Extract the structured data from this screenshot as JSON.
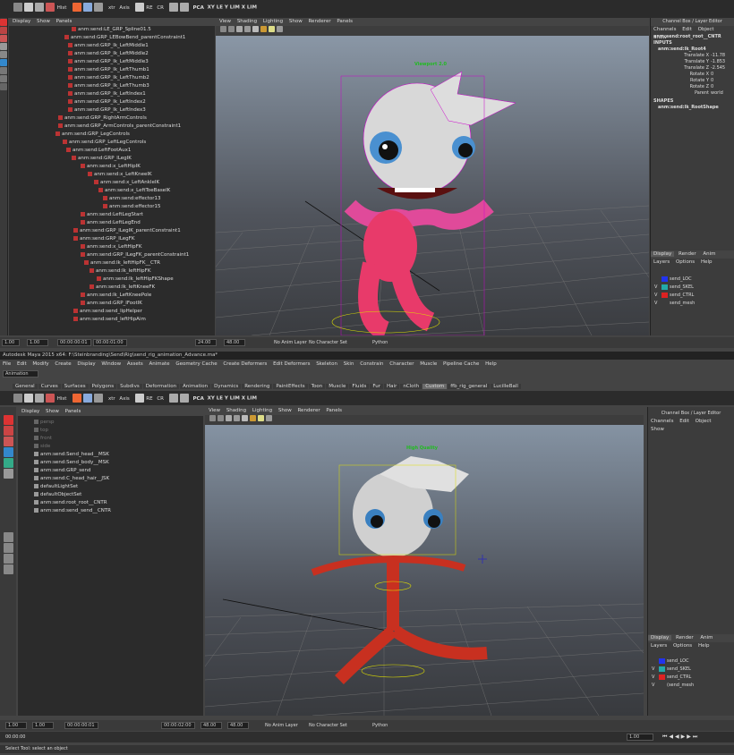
{
  "top": {
    "shelf_labels": [
      "Hist",
      "PCA",
      "XY LE Y LIM X LIM",
      "xtr",
      "Axis",
      "CR",
      "RE"
    ],
    "outliner_menu": [
      "Display",
      "Show",
      "Panels"
    ],
    "outliner_items": [
      "anm:send:LE_GRP_Spline01.5",
      "anm:send:GRP_LEBowBend_parentConstraint1",
      "anm:send:GRP_lk_LeftMiddle1",
      "anm:send:GRP_lk_LeftMiddle2",
      "anm:send:GRP_lk_LeftMiddle3",
      "anm:send:GRP_lk_LeftThumb1",
      "anm:send:GRP_lk_LeftThumb2",
      "anm:send:GRP_lk_LeftThumb3",
      "anm:send:GRP_lk_LeftIndex1",
      "anm:send:GRP_lk_LeftIndex2",
      "anm:send:GRP_lk_LeftIndex3",
      "anm:send:GRP_RightArmControls",
      "anm:send:GRP_ArmControls_parentConstraint1",
      "anm:send:GRP_LegControls",
      "anm:send:GRP_LeftLegControls",
      "anm:send:LeftFootAux1",
      "anm:send:GRP_lLegIK",
      "anm:send:x_LeftHipIK",
      "anm:send:x_LeftKneeIK",
      "anm:send:x_LeftAnkleIK",
      "anm:send:x_LeftToeBaseIK",
      "anm:send:effector13",
      "anm:send:effector15",
      "anm:send:LeftLegStart",
      "anm:send:LeftLegEnd",
      "anm:send:GRP_lLegIK_parentConstraint1",
      "anm:send:GRP_lLegFK",
      "anm:send:x_LeftHipFK",
      "anm:send:GRP_lLegFK_parentConstraint1",
      "anm:send:lk_leftHipFK__CTR",
      "anm:send:lk_leftHipFK",
      "anm:send:lk_leftHipFKShape",
      "anm:send:lk_leftKneeFK",
      "anm:send:lk_LeftKneePole",
      "anm:send:GRP_lFootIK",
      "anm:send:send_lipHelper",
      "anm:send:send_leftHipAim"
    ],
    "viewport_menu": [
      "View",
      "Shading",
      "Lighting",
      "Show",
      "Renderer",
      "Panels"
    ],
    "viewport_label": "Viewport 2.0",
    "channelbox_title": "Channel Box / Layer Editor",
    "channelbox_menu": [
      "Channels",
      "Edit",
      "Object",
      "Show"
    ],
    "node_name": "anm:send:root_root__CNTR",
    "inputs_label": "INPUTS",
    "input_node": "anm:send:lk_Root4",
    "channels": [
      {
        "label": "Translate X",
        "value": "-11.78"
      },
      {
        "label": "Translate Y",
        "value": "-1.853"
      },
      {
        "label": "Translate Z",
        "value": "-2.545"
      },
      {
        "label": "Rotate X",
        "value": "0"
      },
      {
        "label": "Rotate Y",
        "value": "0"
      },
      {
        "label": "Rotate Z",
        "value": "0"
      },
      {
        "label": "Parent",
        "value": "world"
      }
    ],
    "shapes_label": "SHAPES",
    "shape_node": "anm:send:lk_RootShape",
    "layer_tabs": [
      "Display",
      "Render",
      "Anim"
    ],
    "layer_menu": [
      "Layers",
      "Options",
      "Help"
    ],
    "layers": [
      {
        "v": "",
        "name": "send_LOC",
        "color": "#2233ee"
      },
      {
        "v": "V",
        "name": "send_SKEL",
        "color": "#22aaaa"
      },
      {
        "v": "V",
        "name": "send_CTRL",
        "color": "#dd2222"
      },
      {
        "v": "V",
        "name": "send_mesh",
        "color": ""
      }
    ],
    "time_fields": [
      "1.00",
      "1.00",
      "00:00:00:01",
      "00:00:01:00",
      "24.00",
      "48.00"
    ],
    "anim_layer": "No Anim Layer",
    "char_set": "No Character Set",
    "python_label": "Python"
  },
  "bottom": {
    "title": "Autodesk Maya 2015 x64: F:\\Steinbranding\\Send\\Rig\\send_rig_animation_Advance.ma*",
    "menubar": [
      "File",
      "Edit",
      "Modify",
      "Create",
      "Display",
      "Window",
      "Assets",
      "Animate",
      "Geometry Cache",
      "Create Deformers",
      "Edit Deformers",
      "Skeleton",
      "Skin",
      "Constrain",
      "Character",
      "Muscle",
      "Pipeline Cache",
      "Help"
    ],
    "mode": "Animation",
    "shelf_tabs": [
      "General",
      "Curves",
      "Surfaces",
      "Polygons",
      "Subdivs",
      "Deformation",
      "Animation",
      "Dynamics",
      "Rendering",
      "PaintEffects",
      "Toon",
      "Muscle",
      "Fluids",
      "Fur",
      "Hair",
      "nCloth",
      "Custom",
      "ffb_rig_general",
      "LucilleBall"
    ],
    "active_tab": "Custom",
    "shelf_labels": [
      "Hist",
      "PCA",
      "XY LE Y LIM X LIM",
      "xtr",
      "Axis",
      "CR",
      "RE"
    ],
    "outliner_menu": [
      "Display",
      "Show",
      "Panels"
    ],
    "outliner_items": [
      {
        "name": "persp",
        "dim": true
      },
      {
        "name": "top",
        "dim": true
      },
      {
        "name": "front",
        "dim": true
      },
      {
        "name": "side",
        "dim": true
      },
      {
        "name": "anm:send:Send_head__MSK",
        "dim": false
      },
      {
        "name": "anm:send:Send_body__MSK",
        "dim": false
      },
      {
        "name": "anm:send:GRP_send",
        "dim": false
      },
      {
        "name": "anm:send:C_head_hair__JSK",
        "dim": false
      },
      {
        "name": "defaultLightSet",
        "dim": false
      },
      {
        "name": "defaultObjectSet",
        "dim": false
      },
      {
        "name": "anm:send:root_root__CNTR",
        "dim": false
      },
      {
        "name": "anm:send:send_send__CNTR",
        "dim": false
      }
    ],
    "viewport_menu": [
      "View",
      "Shading",
      "Lighting",
      "Show",
      "Renderer",
      "Panels"
    ],
    "viewport_label": "High Quality",
    "channelbox_title": "Channel Box / Layer Editor",
    "channelbox_menu": [
      "Channels",
      "Edit",
      "Object",
      "Show"
    ],
    "layer_tabs": [
      "Display",
      "Render",
      "Anim"
    ],
    "layer_menu": [
      "Layers",
      "Options",
      "Help"
    ],
    "layers": [
      {
        "v": "",
        "name": "send_LOC",
        "color": "#2233ee"
      },
      {
        "v": "V",
        "name": "send_SKEL",
        "color": "#22aaaa"
      },
      {
        "v": "V",
        "name": "send_CTRL",
        "color": "#dd2222"
      },
      {
        "v": "V",
        "name": "(send_mesh",
        "color": ""
      }
    ],
    "time_fields": [
      "1.00",
      "1.00",
      "00:00:00:01",
      "00:00:02:00",
      "48.00",
      "48.00"
    ],
    "anim_layer": "No Anim Layer",
    "char_set": "No Character Set",
    "python_label": "Python",
    "frame_display": "1.00",
    "timecode": "00:00:00",
    "help_line": "Select Tool: select an object"
  }
}
